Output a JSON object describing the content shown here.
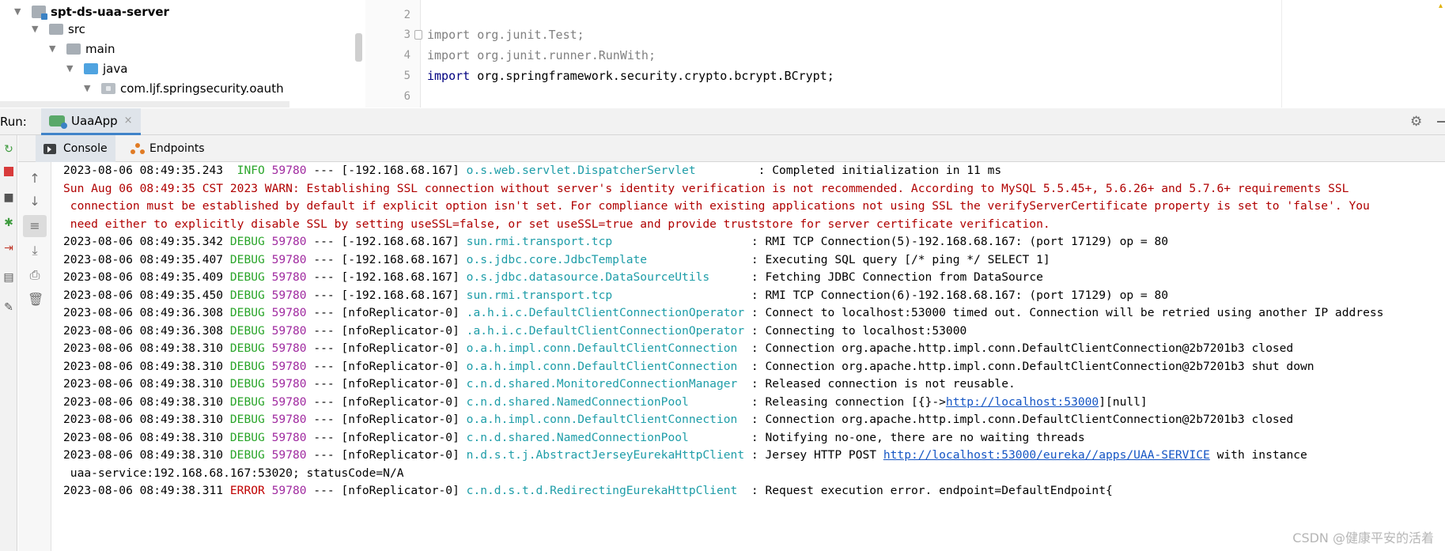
{
  "project_tree": [
    {
      "label": "spt-ds-uaa-server",
      "kind": "module",
      "bold": true
    },
    {
      "label": "src",
      "kind": "folder"
    },
    {
      "label": "main",
      "kind": "folder"
    },
    {
      "label": "java",
      "kind": "source-folder"
    },
    {
      "label": "com.ljf.springsecurity.oauth",
      "kind": "package"
    }
  ],
  "editor": {
    "line_numbers": [
      "2",
      "3",
      "4",
      "5",
      "6"
    ],
    "lines": [
      {
        "keyword": "",
        "path": ""
      },
      {
        "keyword": "import",
        "path": "org.junit.Test;"
      },
      {
        "keyword": "import",
        "path": "org.junit.runner.RunWith;"
      },
      {
        "keyword": "import",
        "path": "org.springframework.security.crypto.bcrypt.BCrypt;"
      },
      {
        "keyword": "",
        "path": ""
      }
    ]
  },
  "run_window": {
    "label": "Run:",
    "tab_label": "UaaApp",
    "tab_close": "×",
    "sub_tabs": {
      "console": "Console",
      "endpoints": "Endpoints"
    }
  },
  "colors": {
    "info_level": "#2aa52a",
    "debug_level": "#2aa52a",
    "error_level": "#c00000",
    "pid": "#a02aa0",
    "logger": "#1e9da8",
    "warning": "#b00000",
    "link": "#1455c4"
  },
  "console": {
    "rows": [
      {
        "ts": "2023-08-06 08:49:35.243",
        "level": " INFO",
        "pid": "59780",
        "thread": " --- [-192.168.68.167] ",
        "logger": "o.s.web.servlet.DispatcherServlet        ",
        "message": ": Completed initialization in 11 ms"
      },
      {
        "warn": "Sun Aug 06 08:49:35 CST 2023 WARN: Establishing SSL connection without server's identity verification is not recommended. According to MySQL 5.5.45+, 5.6.26+ and 5.7.6+ requirements SSL"
      },
      {
        "warn": " connection must be established by default if explicit option isn't set. For compliance with existing applications not using SSL the verifyServerCertificate property is set to 'false'. You"
      },
      {
        "warn": " need either to explicitly disable SSL by setting useSSL=false, or set useSSL=true and provide truststore for server certificate verification."
      },
      {
        "ts": "2023-08-06 08:49:35.342",
        "level": "DEBUG",
        "pid": "59780",
        "thread": " --- [-192.168.68.167] ",
        "logger": "sun.rmi.transport.tcp                   ",
        "message": ": RMI TCP Connection(5)-192.168.68.167: (port 17129) op = 80"
      },
      {
        "ts": "2023-08-06 08:49:35.407",
        "level": "DEBUG",
        "pid": "59780",
        "thread": " --- [-192.168.68.167] ",
        "logger": "o.s.jdbc.core.JdbcTemplate              ",
        "message": ": Executing SQL query [/* ping */ SELECT 1]"
      },
      {
        "ts": "2023-08-06 08:49:35.409",
        "level": "DEBUG",
        "pid": "59780",
        "thread": " --- [-192.168.68.167] ",
        "logger": "o.s.jdbc.datasource.DataSourceUtils     ",
        "message": ": Fetching JDBC Connection from DataSource"
      },
      {
        "ts": "2023-08-06 08:49:35.450",
        "level": "DEBUG",
        "pid": "59780",
        "thread": " --- [-192.168.68.167] ",
        "logger": "sun.rmi.transport.tcp                   ",
        "message": ": RMI TCP Connection(6)-192.168.68.167: (port 17129) op = 80"
      },
      {
        "ts": "2023-08-06 08:49:36.308",
        "level": "DEBUG",
        "pid": "59780",
        "thread": " --- [nfoReplicator-0] ",
        "logger": ".a.h.i.c.DefaultClientConnectionOperator",
        "message": " : Connect to localhost:53000 timed out. Connection will be retried using another IP address"
      },
      {
        "ts": "2023-08-06 08:49:36.308",
        "level": "DEBUG",
        "pid": "59780",
        "thread": " --- [nfoReplicator-0] ",
        "logger": ".a.h.i.c.DefaultClientConnectionOperator",
        "message": " : Connecting to localhost:53000"
      },
      {
        "ts": "2023-08-06 08:49:38.310",
        "level": "DEBUG",
        "pid": "59780",
        "thread": " --- [nfoReplicator-0] ",
        "logger": "o.a.h.impl.conn.DefaultClientConnection ",
        "message": " : Connection org.apache.http.impl.conn.DefaultClientConnection@2b7201b3 closed"
      },
      {
        "ts": "2023-08-06 08:49:38.310",
        "level": "DEBUG",
        "pid": "59780",
        "thread": " --- [nfoReplicator-0] ",
        "logger": "o.a.h.impl.conn.DefaultClientConnection ",
        "message": " : Connection org.apache.http.impl.conn.DefaultClientConnection@2b7201b3 shut down"
      },
      {
        "ts": "2023-08-06 08:49:38.310",
        "level": "DEBUG",
        "pid": "59780",
        "thread": " --- [nfoReplicator-0] ",
        "logger": "c.n.d.shared.MonitoredConnectionManager ",
        "message": " : Released connection is not reusable."
      },
      {
        "ts": "2023-08-06 08:49:38.310",
        "level": "DEBUG",
        "pid": "59780",
        "thread": " --- [nfoReplicator-0] ",
        "logger": "c.n.d.shared.NamedConnectionPool        ",
        "message": " : Releasing connection [{}->",
        "link": "http://localhost:53000",
        "message_after": "][null]"
      },
      {
        "ts": "2023-08-06 08:49:38.310",
        "level": "DEBUG",
        "pid": "59780",
        "thread": " --- [nfoReplicator-0] ",
        "logger": "o.a.h.impl.conn.DefaultClientConnection ",
        "message": " : Connection org.apache.http.impl.conn.DefaultClientConnection@2b7201b3 closed"
      },
      {
        "ts": "2023-08-06 08:49:38.310",
        "level": "DEBUG",
        "pid": "59780",
        "thread": " --- [nfoReplicator-0] ",
        "logger": "c.n.d.shared.NamedConnectionPool        ",
        "message": " : Notifying no-one, there are no waiting threads"
      },
      {
        "ts": "2023-08-06 08:49:38.310",
        "level": "DEBUG",
        "pid": "59780",
        "thread": " --- [nfoReplicator-0] ",
        "logger": "n.d.s.t.j.AbstractJerseyEurekaHttpClient",
        "message": " : Jersey HTTP POST ",
        "link": "http://localhost:53000/eureka//apps/UAA-SERVICE",
        "message_after": " with instance"
      },
      {
        "plain": " uaa-service:192.168.68.167:53020; statusCode=N/A"
      },
      {
        "ts": "2023-08-06 08:49:38.311",
        "level": "ERROR",
        "pid": "59780",
        "thread": " --- [nfoReplicator-0] ",
        "logger": "c.n.d.s.t.d.RedirectingEurekaHttpClient ",
        "message": " : Request execution error. endpoint=DefaultEndpoint{"
      }
    ]
  },
  "watermark": "CSDN @健康平安的活着"
}
